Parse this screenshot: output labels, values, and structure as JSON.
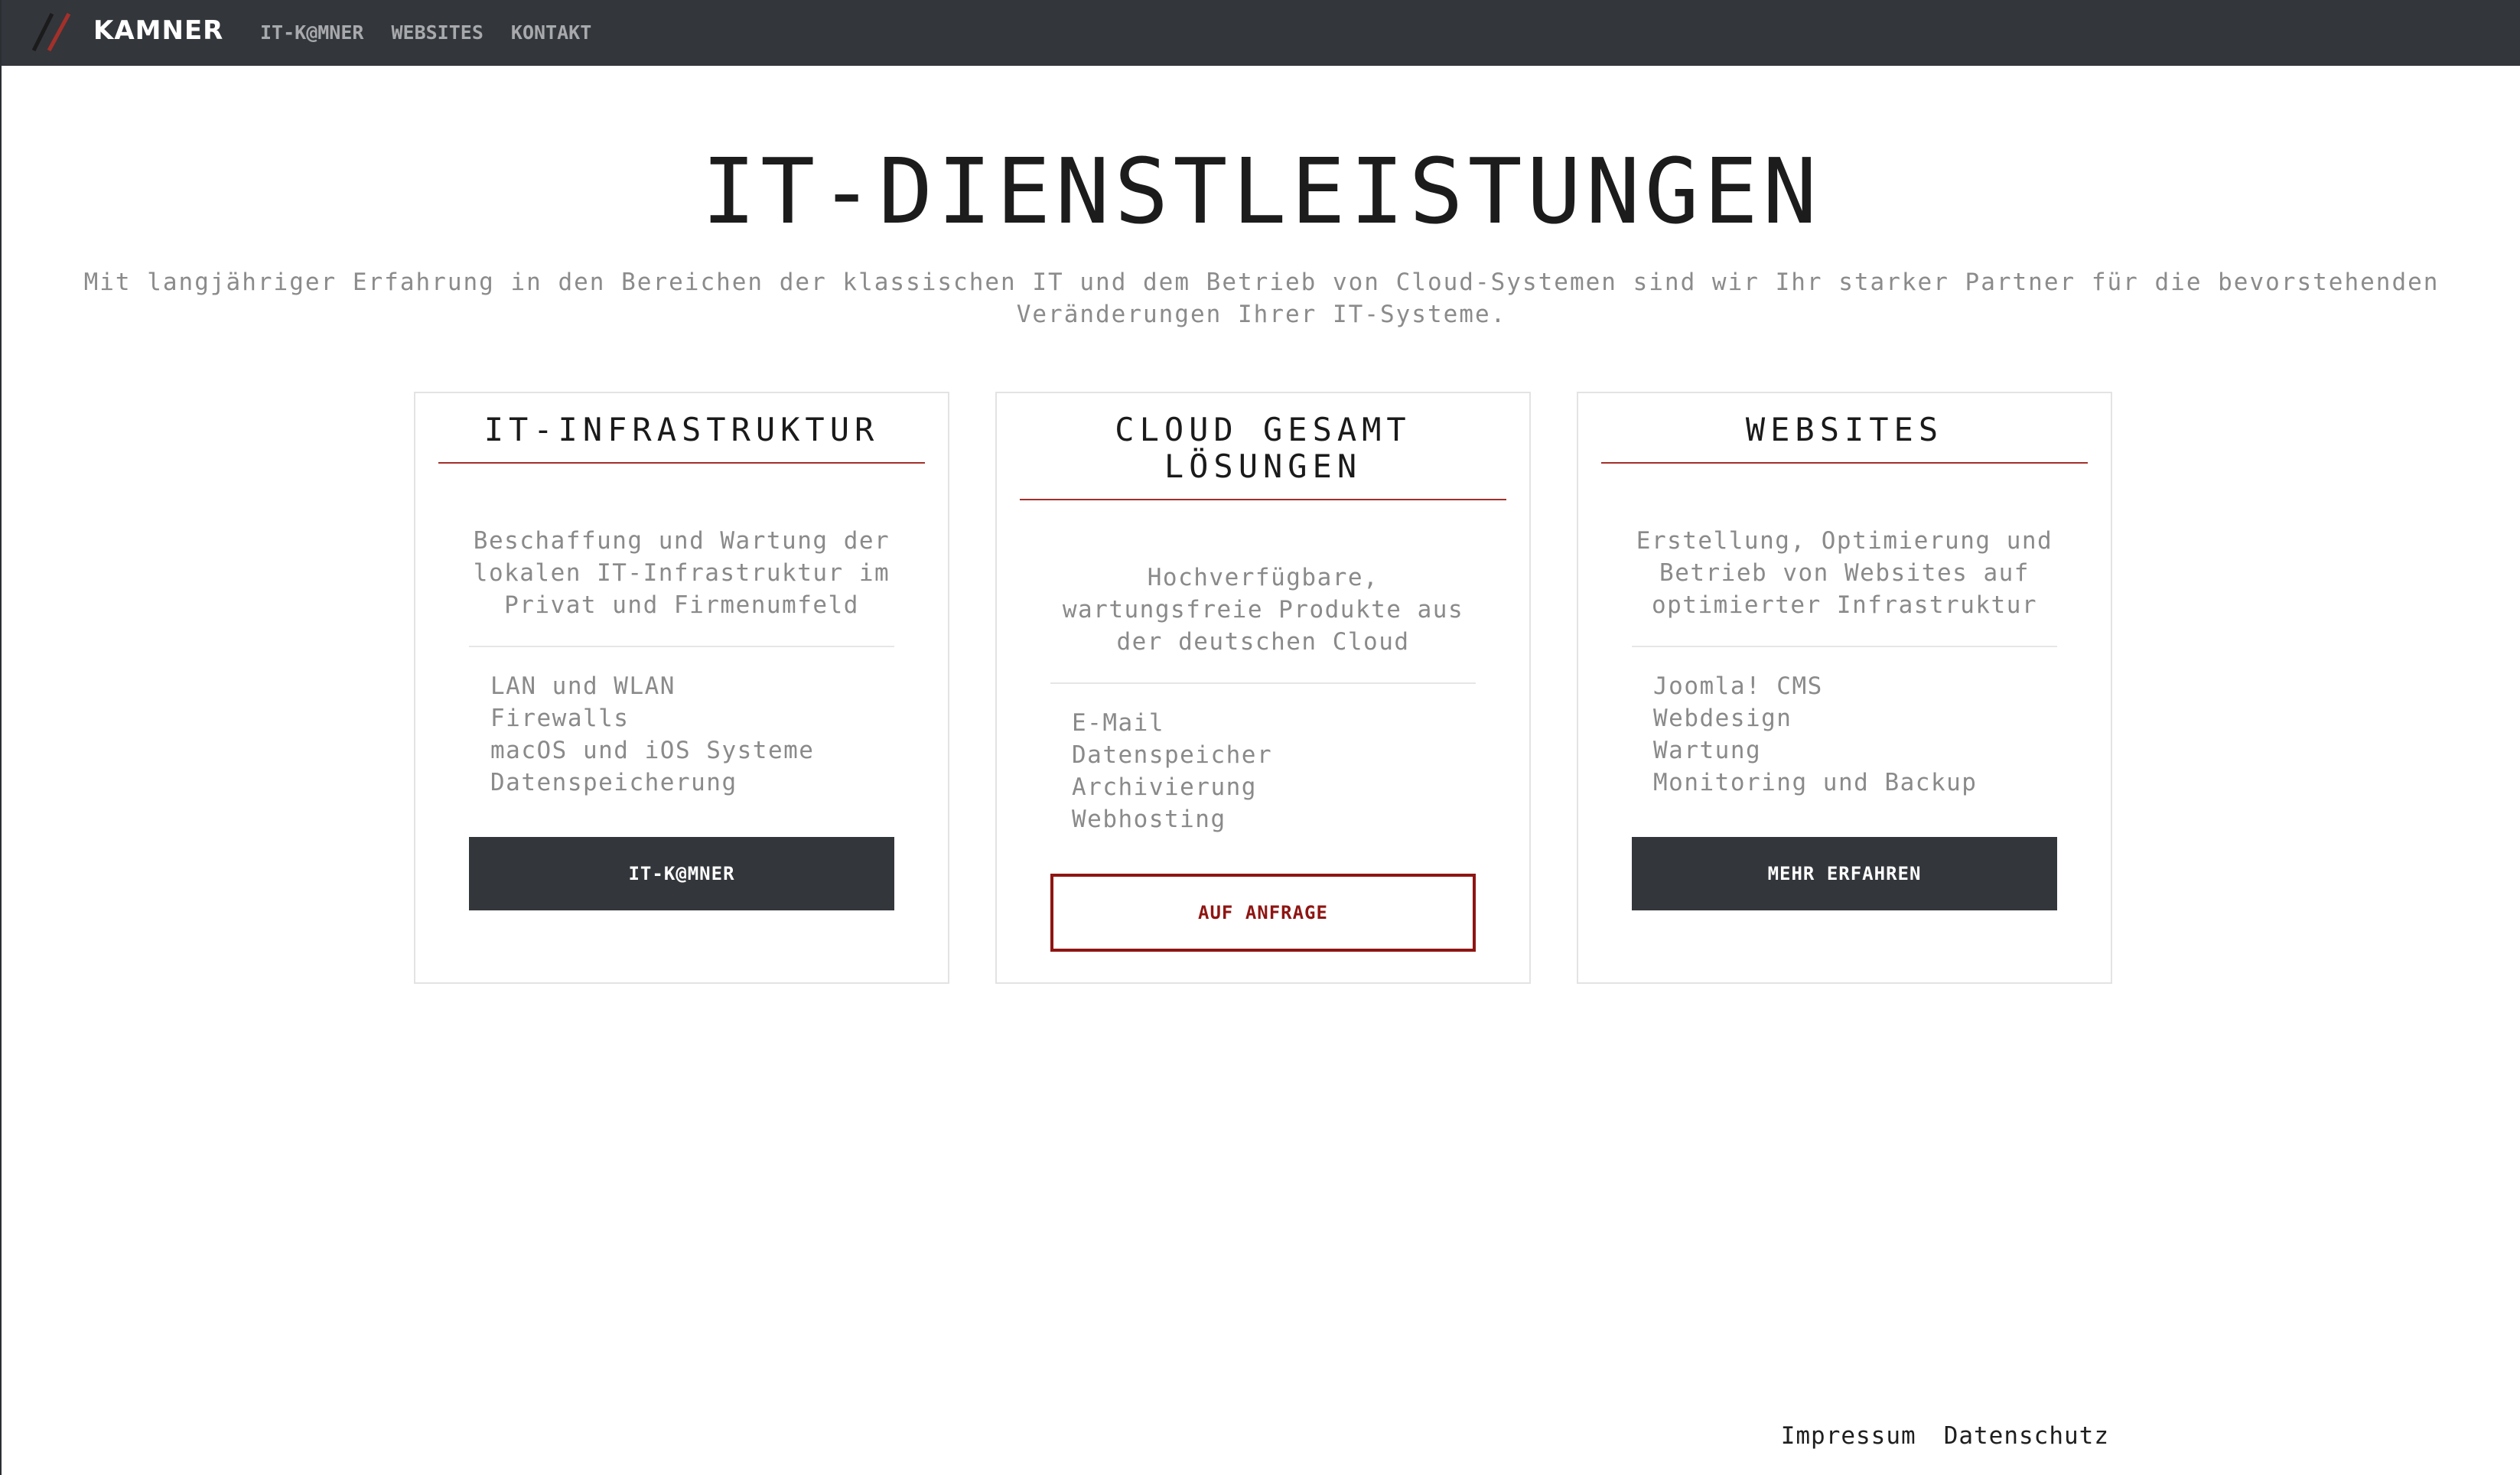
{
  "nav": {
    "brand": "KAMNER",
    "links": [
      "IT-K@MNER",
      "WEBSITES",
      "KONTAKT"
    ]
  },
  "hero": {
    "title": "IT-DIENSTLEISTUNGEN",
    "subtitle": "Mit langjähriger Erfahrung in den Bereichen der klassischen IT und dem Betrieb von Cloud-Systemen sind wir Ihr starker Partner für die bevorstehenden Veränderungen Ihrer IT-Systeme."
  },
  "cards": [
    {
      "title": "IT-INFRASTRUKTUR",
      "description": "Beschaffung und Wartung der lokalen IT-Infrastruktur im Privat und Firmenumfeld",
      "items": [
        "LAN und WLAN",
        "Firewalls",
        "macOS und iOS Systeme",
        "Datenspeicherung"
      ],
      "button": "IT-K@MNER"
    },
    {
      "title": "CLOUD GESAMT LÖSUNGEN",
      "description": "Hochverfügbare, wartungsfreie Produkte aus der deutschen Cloud",
      "items": [
        "E-Mail",
        "Datenspeicher",
        "Archivierung",
        "Webhosting"
      ],
      "button": "AUF ANFRAGE"
    },
    {
      "title": "WEBSITES",
      "description": "Erstellung, Optimierung und Betrieb von Websites auf optimierter Infrastruktur",
      "items": [
        "Joomla! CMS",
        "Webdesign",
        "Wartung",
        "Monitoring und Backup"
      ],
      "button": "MEHR ERFAHREN"
    }
  ],
  "footer": {
    "links": [
      "Impressum",
      "Datenschutz"
    ]
  },
  "colors": {
    "navbar": "#33363b",
    "accent": "#a3302a",
    "outline_button": "#8e1512",
    "muted_text": "#8a8a8a"
  }
}
